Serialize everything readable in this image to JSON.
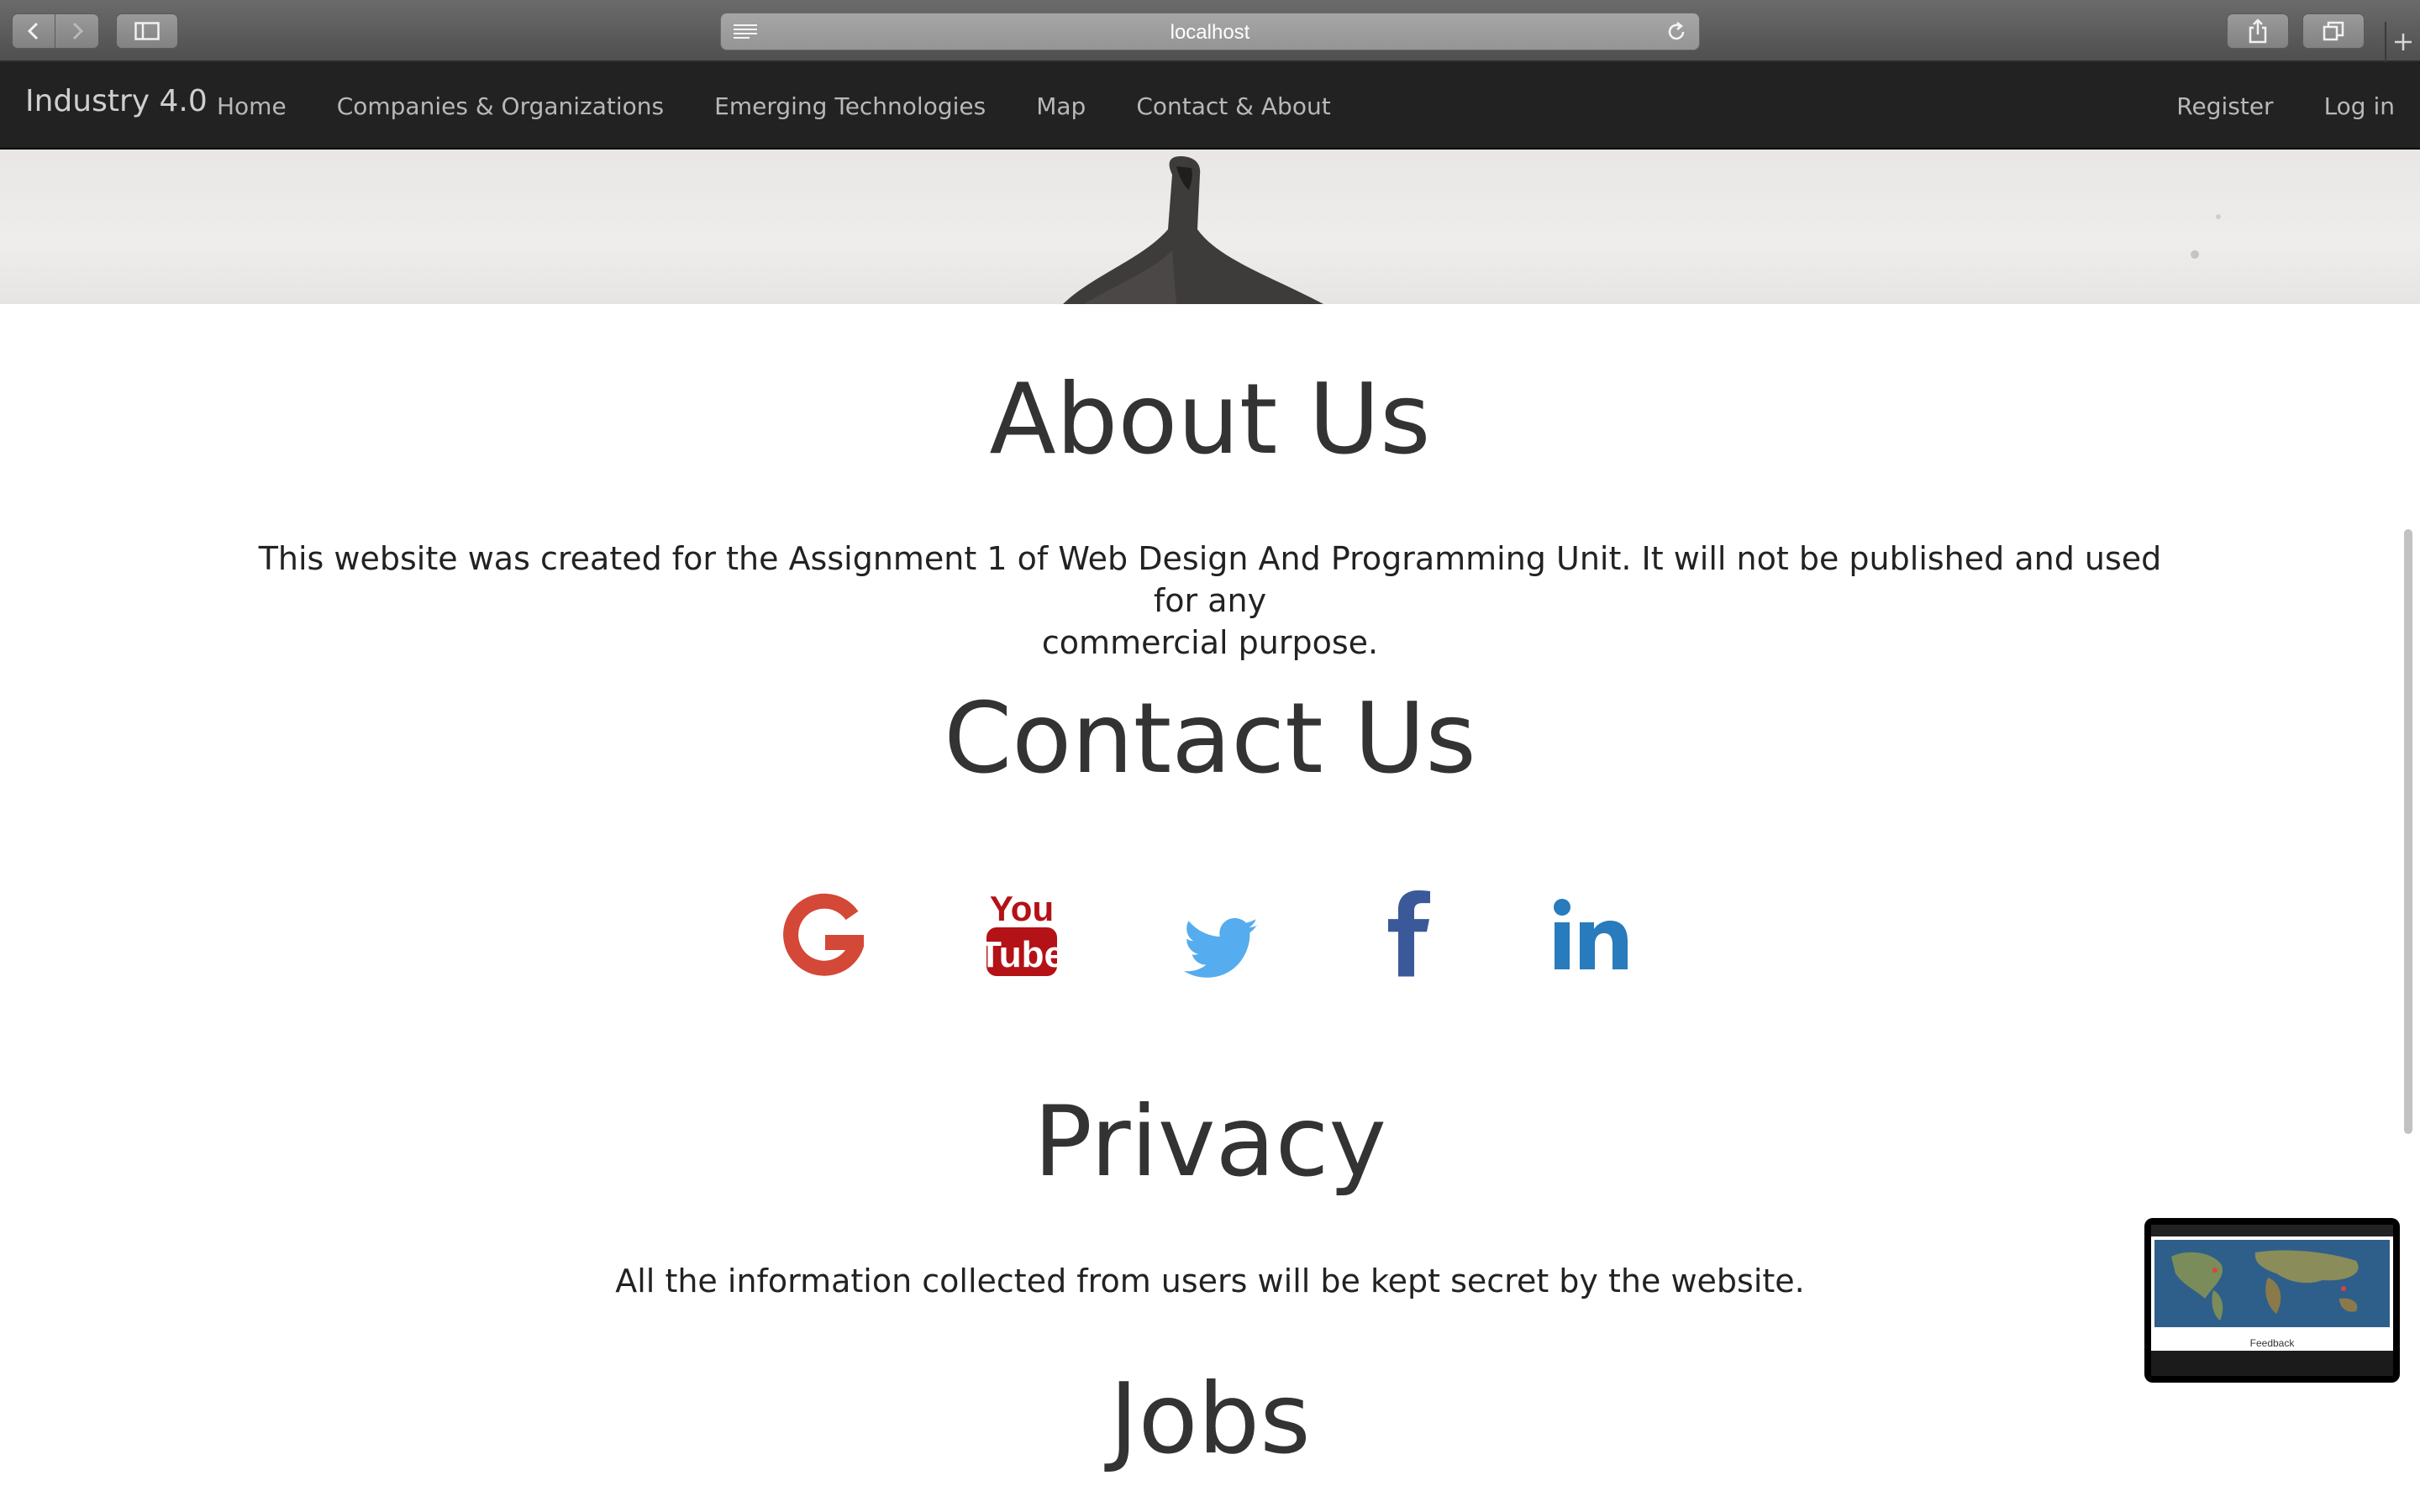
{
  "browser": {
    "url": "localhost"
  },
  "navbar": {
    "brand": "Industry 4.0",
    "links": [
      "Home",
      "Companies & Organizations",
      "Emerging Technologies",
      "Map",
      "Contact & About"
    ],
    "right_links": [
      "Register",
      "Log in"
    ]
  },
  "about": {
    "heading": "About Us",
    "text_line1": "This website was created for the Assignment 1 of Web Design And Programming Unit. It will not be published and used for any",
    "text_line2": "commercial purpose."
  },
  "contact": {
    "heading": "Contact Us",
    "social_icons": [
      "google-icon",
      "youtube-icon",
      "twitter-icon",
      "facebook-icon",
      "linkedin-icon"
    ],
    "youtube_top": "You",
    "youtube_bottom": "Tube"
  },
  "privacy": {
    "heading": "Privacy",
    "text": "All the information collected from users will be kept secret by the website."
  },
  "jobs": {
    "heading": "Jobs"
  },
  "feedback_preview": {
    "label": "Feedback"
  },
  "colors": {
    "google": "#d34836",
    "youtube": "#b31217",
    "twitter": "#55acee",
    "facebook": "#3b5998",
    "linkedin": "#287bbc",
    "navbar": "#222222"
  }
}
